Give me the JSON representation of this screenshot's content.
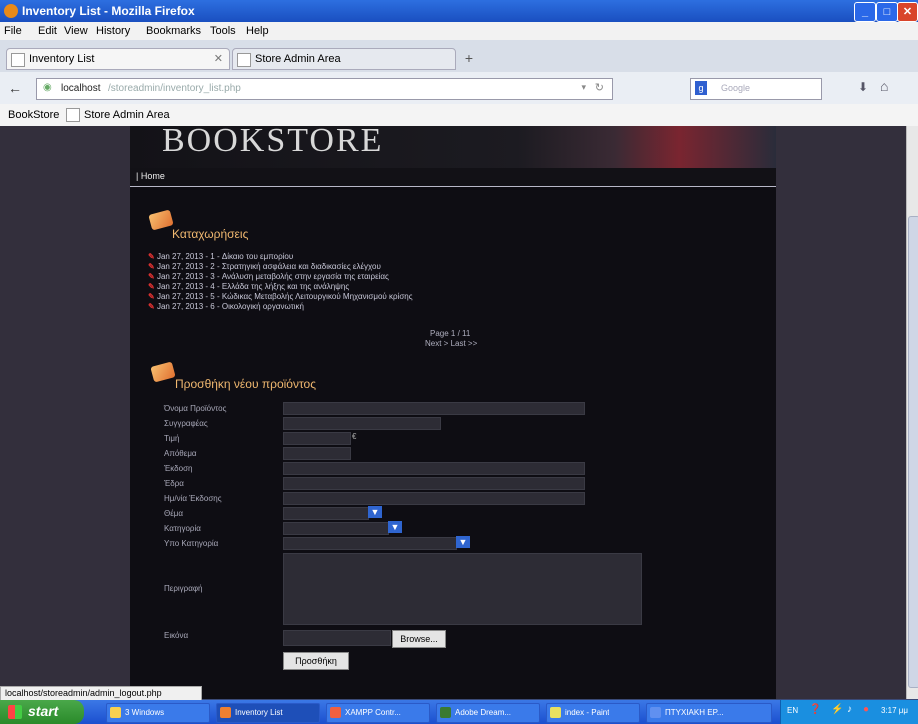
{
  "window": {
    "title": "Inventory List - Mozilla Firefox"
  },
  "menu": [
    "File",
    "Edit",
    "View",
    "History",
    "Bookmarks",
    "Tools",
    "Help"
  ],
  "tabs": [
    {
      "label": "Inventory List"
    },
    {
      "label": "Store Admin Area"
    }
  ],
  "nav": {
    "url_host": "localhost",
    "url_path": "/storeadmin/inventory_list.php",
    "search_placeholder": "Google"
  },
  "bookmarks": [
    "BookStore",
    "Store Admin Area"
  ],
  "site": {
    "logo": "BOOKSTORE",
    "nav_home": "| Home"
  },
  "listings": {
    "title": "Καταχωρήσεις",
    "items": [
      "Jan 27, 2013 - 1 - Δίκαιο του εμπορίου",
      "Jan 27, 2013 - 2 - Στρατηγική ασφάλεια και διαδικασίες ελέγχου",
      "Jan 27, 2013 - 3 - Ανάλυση μεταβολής στην εργασία της εταιρείας",
      "Jan 27, 2013 - 4 - Ελλάδα της λήξης και της ανάληψης",
      "Jan 27, 2013 - 5 - Κώδικας Μεταβολής Λειτουργικού Μηχανισμού κρίσης",
      "Jan 27, 2013 - 6 - Οικολογική οργανωτική"
    ],
    "page_text": "Page 1 / 11",
    "nav_text": "Next > Last >>"
  },
  "form": {
    "title": "Προσθήκη νέου προϊόντος",
    "labels": {
      "name": "Όνομα Προϊόντος",
      "author": "Συγγραφέας",
      "price": "Τιμή",
      "stock": "Απόθεμα",
      "edition": "Έκδοση",
      "publisher": "Έδρα",
      "date": "Ημ/νία Έκδοσης",
      "theme": "Θέμα",
      "category": "Κατηγορία",
      "subcategory": "Υπο Κατηγορία",
      "description": "Περιγραφή",
      "image": "Εικόνα"
    },
    "price_currency": "€",
    "browse_label": "Browse...",
    "submit_label": "Προσθήκη"
  },
  "status_text": "localhost/storeadmin/admin_logout.php",
  "taskbar": {
    "start_label": "start",
    "tasks": [
      "3 Windows",
      "Inventory List",
      "XAMPP Contr...",
      "Adobe Dream...",
      "index - Paint",
      "ΠΤΥΧΙΑΚΗ ΕΡ..."
    ],
    "tray_lang": "EN",
    "tray_time": "3:17 μμ"
  }
}
